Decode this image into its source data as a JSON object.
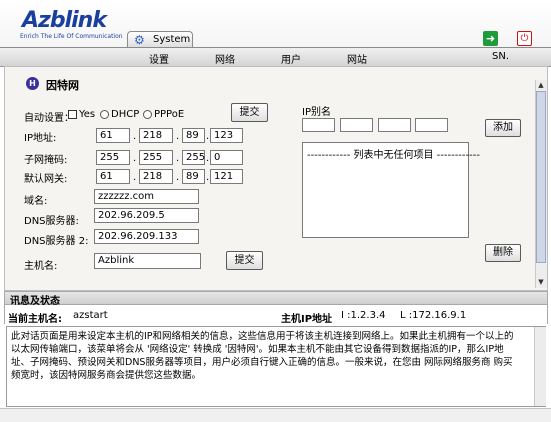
{
  "header": {
    "logo": "Azblink",
    "tagline": "Enrich The Life Of Communication",
    "active_tab": "System"
  },
  "menu": [
    "设置",
    "网络",
    "用户",
    "网站",
    "SN."
  ],
  "section": {
    "title": "因特网",
    "auto_setting_label": "自动设置：",
    "options": {
      "yes": "Yes",
      "dhcp": "DHCP",
      "pppoe": "PPPoE"
    },
    "submit_label": "提交",
    "ip_label": "IP地址:",
    "ip": [
      "61",
      "218",
      "89",
      "123"
    ],
    "mask_label": "子网掩码:",
    "mask": [
      "255",
      "255",
      "255",
      "0"
    ],
    "gateway_label": "默认网关:",
    "gateway": [
      "61",
      "218",
      "89",
      "121"
    ],
    "domain_label": "域名:",
    "domain": "zzzzzz.com",
    "dns1_label": "DNS服务器:",
    "dns1": "202.96.209.5",
    "dns2_label": "DNS服务器 2:",
    "dns2": "202.96.209.133",
    "hostname_label": "主机名:",
    "hostname": "Azblink",
    "hostname_submit": "提交"
  },
  "alias": {
    "label": "IP别名",
    "add_label": "添加",
    "empty_text": "------------ 列表中无任何项目 ------------",
    "delete_label": "删除"
  },
  "status": {
    "title": "讯息及状态",
    "current_host_label": "当前主机名:",
    "current_host": "azstart",
    "host_ip_label": "主机IP地址",
    "host_ip_i": "I :1.2.3.4",
    "host_ip_l": "L :172.16.9.1",
    "message": "此对话页面是用来设定本主机的IP和网络相关的信息，这些信息用于将该主机连接到网络上。如果此主机拥有一个以上的以太网传输端口，该菜单将会从 '网络设定' 转换成 '因特网'。如果本主机不能由其它设备得到数据指派的IP，那么IP地址、子网掩码、预设网关和DNS服务器等项目，用户必须自行键入正确的信息。一般来说，在您由 网际网络服务商 购买频宽时，该因特网服务商会提供您这些数据。"
  },
  "colors": {
    "logo": "#1a3f9e",
    "exit": "#1e9c3a",
    "power": "#cc1111",
    "panel": "#f5f4f0"
  }
}
